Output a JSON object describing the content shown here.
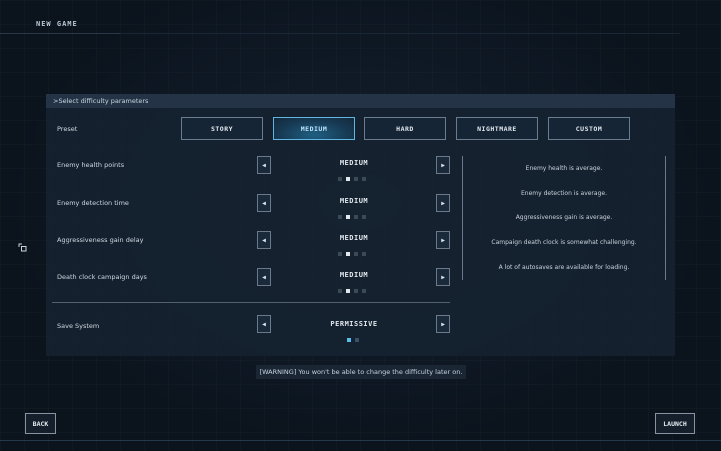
{
  "window": {
    "title": "NEW GAME"
  },
  "panel": {
    "header": ">Select difficulty parameters"
  },
  "preset": {
    "label": "Preset",
    "buttons": [
      "STORY",
      "MEDIUM",
      "HARD",
      "NIGHTMARE",
      "CUSTOM"
    ],
    "selected": "MEDIUM"
  },
  "settings": [
    {
      "label": "Enemy health points",
      "value": "MEDIUM",
      "level": 2,
      "levels": 4
    },
    {
      "label": "Enemy detection time",
      "value": "MEDIUM",
      "level": 2,
      "levels": 4
    },
    {
      "label": "Aggressiveness gain delay",
      "value": "MEDIUM",
      "level": 2,
      "levels": 4
    },
    {
      "label": "Death clock campaign days",
      "value": "MEDIUM",
      "level": 2,
      "levels": 4
    }
  ],
  "save_system": {
    "label": "Save System",
    "value": "PERMISSIVE",
    "level": 1,
    "levels": 2
  },
  "descriptions": [
    "Enemy health is average.",
    "Enemy detection is average.",
    "Aggressiveness gain is average.",
    "Campaign death clock is somewhat challenging.",
    "A lot of autosaves are available for loading."
  ],
  "warning": "[WARNING] You won't be able to change the difficulty later on.",
  "footer": {
    "back_label": "BACK",
    "launch_label": "LAUNCH"
  },
  "icons": {
    "left_arrow": "chevron-left-icon",
    "right_arrow": "chevron-right-icon",
    "side": "expand-icon"
  },
  "colors": {
    "accent": "#5bbde8",
    "background": "#0b131d",
    "panel": "#162230"
  }
}
